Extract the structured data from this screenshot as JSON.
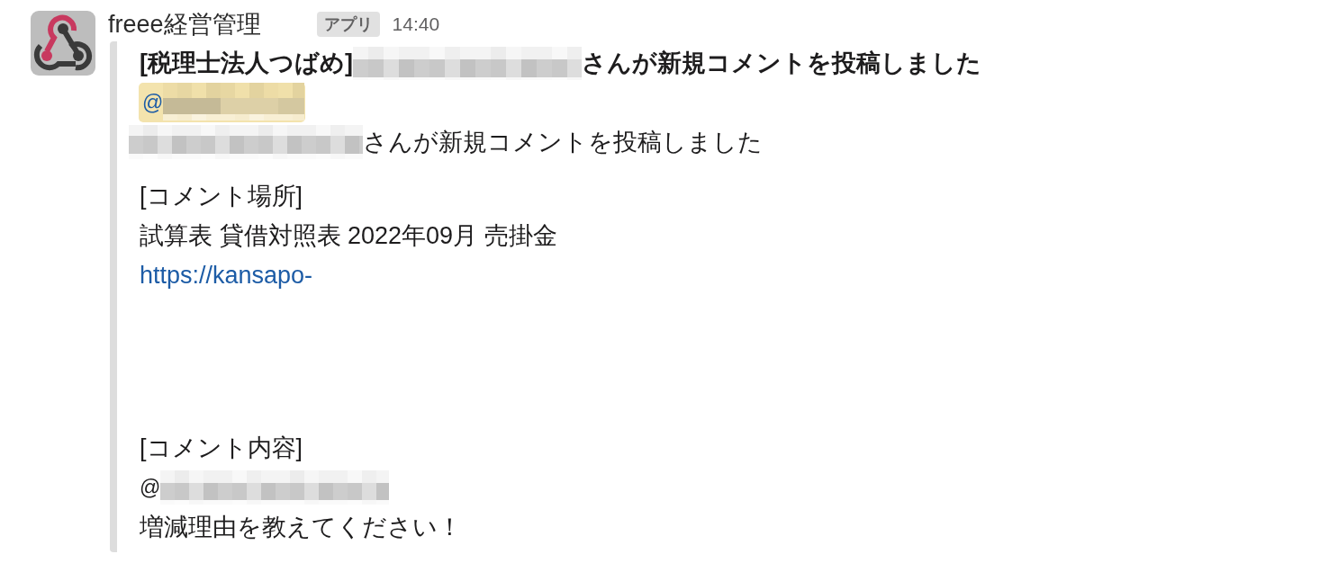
{
  "message": {
    "sender": "freee経営管理",
    "badge": "アプリ",
    "time": "14:40",
    "attachment": {
      "title": {
        "prefix": "[税理士法人つばめ]",
        "redacted_name": true,
        "suffix": "さんが新規コメントを投稿しました"
      },
      "mention": {
        "at": "@",
        "highlighted": true,
        "redacted_name": true
      },
      "author_line": {
        "redacted_name": true,
        "text": "さんが新規コメントを投稿しました"
      },
      "location": {
        "heading": "[コメント場所]",
        "path": "試算表 貸借対照表 2022年09月 売掛金",
        "link": "https://kansapo-"
      },
      "content": {
        "heading": "[コメント内容]",
        "mention": {
          "at": "@",
          "highlighted": false,
          "redacted_name": true
        },
        "body": "増減理由を教えてください！"
      }
    }
  }
}
